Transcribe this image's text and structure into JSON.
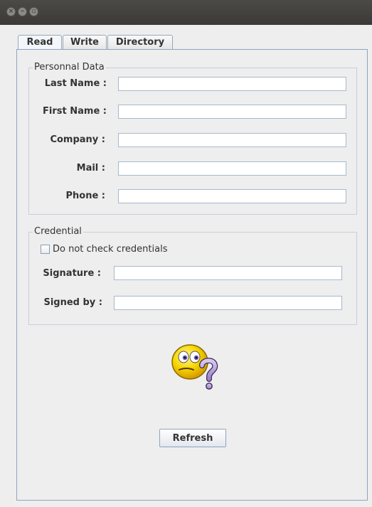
{
  "window": {
    "controls": [
      "close-icon",
      "minimize-icon",
      "maximize-icon"
    ]
  },
  "tabs": [
    {
      "label": "Read",
      "active": true
    },
    {
      "label": "Write",
      "active": false
    },
    {
      "label": "Directory",
      "active": false
    }
  ],
  "personal": {
    "legend": "Personnal Data",
    "last_name_label": "Last Name :",
    "last_name_value": "",
    "first_name_label": "First Name :",
    "first_name_value": "",
    "company_label": "Company :",
    "company_value": "",
    "mail_label": "Mail :",
    "mail_value": "",
    "phone_label": "Phone :",
    "phone_value": ""
  },
  "credential": {
    "legend": "Credential",
    "check_label": "Do not check credentials",
    "checked": false,
    "signature_label": "Signature :",
    "signature_value": "",
    "signed_by_label": "Signed by :",
    "signed_by_value": ""
  },
  "status_icon": "confused-emoticon-icon",
  "refresh_label": "Refresh",
  "colors": {
    "titlebar": "#3c3b37",
    "panel_border": "#8ea4c0",
    "background": "#eeeeee"
  }
}
